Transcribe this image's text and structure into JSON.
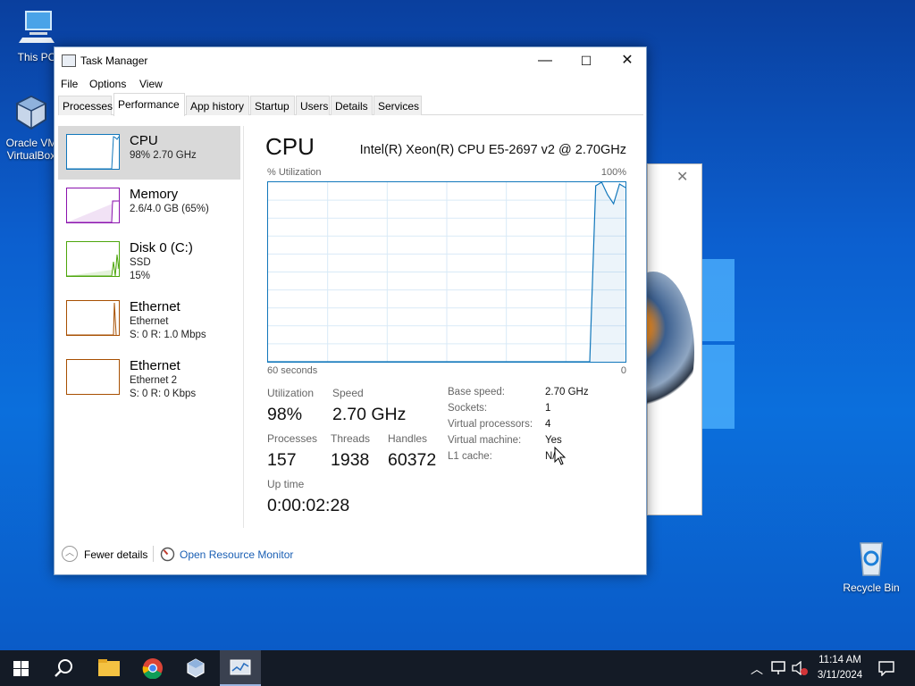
{
  "desktop": {
    "icons": [
      {
        "label": "This PC"
      },
      {
        "label": "Oracle VM VirtualBox"
      },
      {
        "label": "Recycle Bin"
      }
    ]
  },
  "window": {
    "title": "Task Manager",
    "controls": {
      "minimize": "—",
      "maximize": "☐",
      "close": "✕"
    }
  },
  "menu": [
    "File",
    "Options",
    "View"
  ],
  "tabs": [
    "Processes",
    "Performance",
    "App history",
    "Startup",
    "Users",
    "Details",
    "Services"
  ],
  "active_tab": "Performance",
  "sidebar": {
    "items": [
      {
        "title": "CPU",
        "sub1": "98%  2.70 GHz",
        "sub2": "",
        "color": "#1177bb",
        "selected": true
      },
      {
        "title": "Memory",
        "sub1": "2.6/4.0 GB (65%)",
        "sub2": "",
        "color": "#8b12ae",
        "selected": false
      },
      {
        "title": "Disk 0 (C:)",
        "sub1": "SSD",
        "sub2": "15%",
        "color": "#4da60c",
        "selected": false
      },
      {
        "title": "Ethernet",
        "sub1": "Ethernet",
        "sub2": "S: 0  R: 1.0 Mbps",
        "color": "#a74f01",
        "selected": false
      },
      {
        "title": "Ethernet",
        "sub1": "Ethernet 2",
        "sub2": "S: 0  R: 0 Kbps",
        "color": "#a74f01",
        "selected": false
      }
    ]
  },
  "main": {
    "title": "CPU",
    "cpu_model": "Intel(R) Xeon(R) CPU E5-2697 v2 @ 2.70GHz",
    "graph": {
      "y_label": "% Utilization",
      "y_max_label": "100%",
      "x_left_label": "60 seconds",
      "x_right_label": "0"
    },
    "stats": {
      "utilization_label": "Utilization",
      "utilization": "98%",
      "speed_label": "Speed",
      "speed": "2.70 GHz",
      "processes_label": "Processes",
      "processes": "157",
      "threads_label": "Threads",
      "threads": "1938",
      "handles_label": "Handles",
      "handles": "60372",
      "uptime_label": "Up time",
      "uptime": "0:00:02:28"
    },
    "details": [
      {
        "label": "Base speed:",
        "value": "2.70 GHz"
      },
      {
        "label": "Sockets:",
        "value": "1"
      },
      {
        "label": "Virtual processors:",
        "value": "4"
      },
      {
        "label": "Virtual machine:",
        "value": "Yes"
      },
      {
        "label": "L1 cache:",
        "value": "N/"
      }
    ]
  },
  "chart_data": {
    "type": "area",
    "title": "% Utilization",
    "xlabel": "",
    "ylabel": "",
    "x_range_label": [
      "60 seconds",
      "0"
    ],
    "ylim": [
      0,
      100
    ],
    "x": [
      0,
      54,
      55,
      56,
      57,
      58,
      59,
      60
    ],
    "values": [
      0,
      0,
      98,
      100,
      93,
      88,
      99,
      97
    ],
    "grid": true,
    "color": "#1177bb"
  },
  "footer": {
    "fewer_details": "Fewer details",
    "open_monitor": "Open Resource Monitor"
  },
  "taskbar": {
    "time": "11:14 AM",
    "date": "3/11/2024"
  }
}
